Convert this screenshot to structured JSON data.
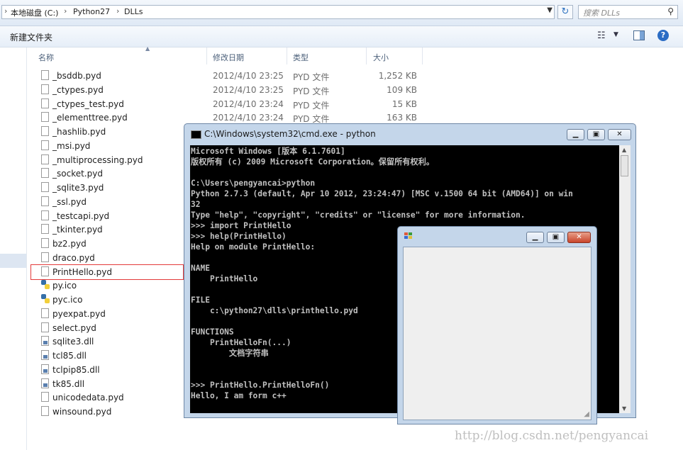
{
  "address": {
    "crumbs": [
      "本地磁盘 (C:)",
      "Python27",
      "DLLs"
    ],
    "search_placeholder": "搜索 DLLs"
  },
  "toolbar": {
    "new_folder": "新建文件夹",
    "help": "?"
  },
  "columns": {
    "name": "名称",
    "date": "修改日期",
    "type": "类型",
    "size": "大小"
  },
  "files": [
    {
      "name": "_bsddb.pyd",
      "date": "2012/4/10 23:25",
      "type": "PYD 文件",
      "size": "1,252 KB",
      "icon": "file-icon"
    },
    {
      "name": "_ctypes.pyd",
      "date": "2012/4/10 23:25",
      "type": "PYD 文件",
      "size": "109 KB",
      "icon": "file-icon"
    },
    {
      "name": "_ctypes_test.pyd",
      "date": "2012/4/10 23:24",
      "type": "PYD 文件",
      "size": "15 KB",
      "icon": "file-icon"
    },
    {
      "name": "_elementtree.pyd",
      "date": "2012/4/10 23:24",
      "type": "PYD 文件",
      "size": "163 KB",
      "icon": "file-icon"
    },
    {
      "name": "_hashlib.pyd",
      "icon": "file-icon"
    },
    {
      "name": "_msi.pyd",
      "icon": "file-icon"
    },
    {
      "name": "_multiprocessing.pyd",
      "icon": "file-icon"
    },
    {
      "name": "_socket.pyd",
      "icon": "file-icon"
    },
    {
      "name": "_sqlite3.pyd",
      "icon": "file-icon"
    },
    {
      "name": "_ssl.pyd",
      "icon": "file-icon"
    },
    {
      "name": "_testcapi.pyd",
      "icon": "file-icon"
    },
    {
      "name": "_tkinter.pyd",
      "icon": "file-icon"
    },
    {
      "name": "bz2.pyd",
      "icon": "file-icon"
    },
    {
      "name": "draco.pyd",
      "icon": "file-icon"
    },
    {
      "name": "PrintHello.pyd",
      "icon": "file-icon",
      "selected": true
    },
    {
      "name": "py.ico",
      "icon": "python-icon"
    },
    {
      "name": "pyc.ico",
      "icon": "python-icon"
    },
    {
      "name": "pyexpat.pyd",
      "icon": "file-icon"
    },
    {
      "name": "select.pyd",
      "icon": "file-icon"
    },
    {
      "name": "sqlite3.dll",
      "icon": "dll-icon"
    },
    {
      "name": "tcl85.dll",
      "icon": "dll-icon"
    },
    {
      "name": "tclpip85.dll",
      "icon": "dll-icon"
    },
    {
      "name": "tk85.dll",
      "icon": "dll-icon"
    },
    {
      "name": "unicodedata.pyd",
      "icon": "file-icon"
    },
    {
      "name": "winsound.pyd",
      "icon": "file-icon"
    }
  ],
  "cmd": {
    "title": "C:\\Windows\\system32\\cmd.exe - python",
    "lines": [
      "Microsoft Windows [版本 6.1.7601]",
      "版权所有 (c) 2009 Microsoft Corporation。保留所有权利。",
      "",
      "C:\\Users\\pengyancai>python",
      "Python 2.7.3 (default, Apr 10 2012, 23:24:47) [MSC v.1500 64 bit (AMD64)] on win",
      "32",
      "Type \"help\", \"copyright\", \"credits\" or \"license\" for more information.",
      ">>> import PrintHello",
      ">>> help(PrintHello)",
      "Help on module PrintHello:",
      "",
      "NAME",
      "    PrintHello",
      "",
      "FILE",
      "    c:\\python27\\dlls\\printhello.pyd",
      "",
      "FUNCTIONS",
      "    PrintHelloFn(...)",
      "        文档字符串",
      "",
      "",
      ">>> PrintHello.PrintHelloFn()",
      "Hello, I am form c++"
    ]
  },
  "colors": {
    "console_bg": "#000000",
    "console_fg": "#c0c0c0",
    "selection_border": "#e33a3a",
    "frame": "#c4d6ea"
  },
  "watermark": "http://blog.csdn.net/pengyancai"
}
